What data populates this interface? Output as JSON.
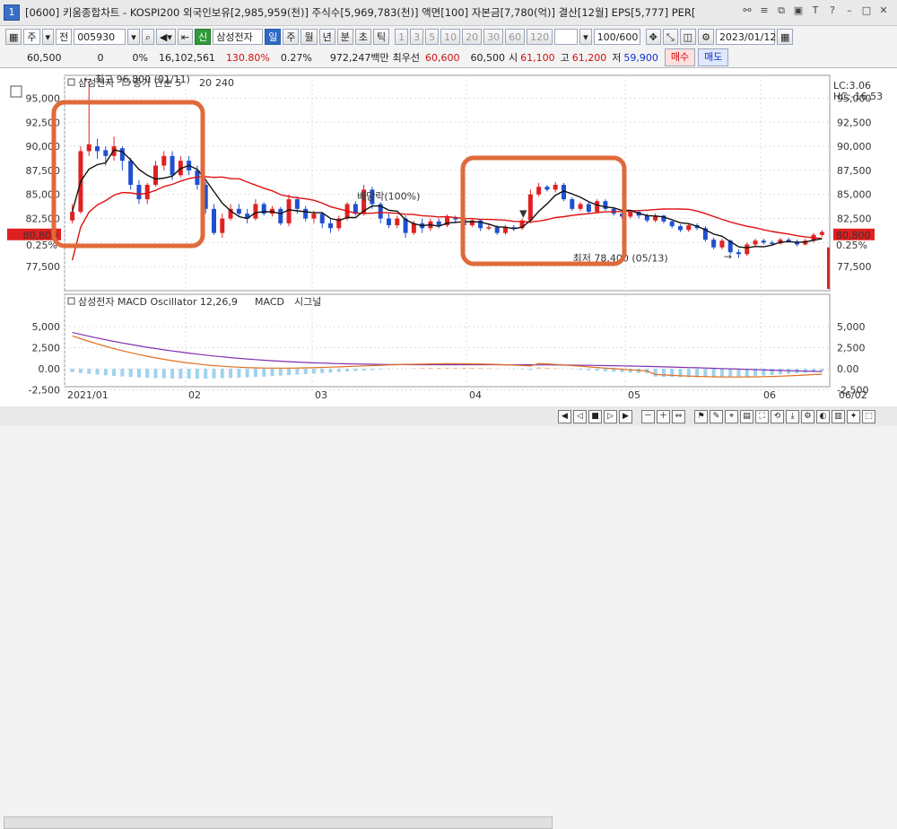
{
  "window": {
    "number": "1",
    "title": "[0600] 키움종합차트 - KOSPI200 외국인보유[2,985,959(천)] 주식수[5,969,783(천)] 액면[100] 자본금[7,780(억)] 결산[12월] EPS[5,777] PER["
  },
  "toolbar": {
    "type_label": "주",
    "market_label": "전",
    "code": "005930",
    "stock_name": "삼성전자",
    "periods": [
      "일",
      "주",
      "월",
      "년",
      "분",
      "초",
      "틱"
    ],
    "intervals": [
      "1",
      "3",
      "5",
      "10",
      "20",
      "30",
      "60",
      "120"
    ],
    "count": "100/600",
    "date": "2023/01/12"
  },
  "quote": {
    "price": "60,500",
    "change": "0",
    "rate": "0%",
    "volume": "16,102,561",
    "vol_ratio": "130.80%",
    "turnover": "0.27%",
    "amount": "972,247백만",
    "best_label": "최우선",
    "best_ask": "60,600",
    "best_bid": "60,500",
    "open_label": "시",
    "open": "61,100",
    "high_label": "고",
    "high": "61,200",
    "low_label": "저",
    "low": "59,900",
    "buy_label": "매수",
    "sell_label": "매도"
  },
  "chart": {
    "price_legend_name": "삼성전자",
    "ma_legend": "종가 단순 5",
    "ma20": "20",
    "ma240": "240",
    "max_label": "최고 96,800 (01/11)",
    "min_label": "최저 78,400 (05/13)",
    "dividend_label": "배당락(100%)",
    "current_price": "80,800",
    "current_rate": "0.25%",
    "lc_label": "LC:3.06",
    "hc_label": "HC:-16.53",
    "price_ticks": [
      "95,000",
      "92,500",
      "90,000",
      "87,500",
      "85,000",
      "82,500",
      "80,000",
      "77,500"
    ],
    "macd_legend": "삼성전자 MACD Oscillator 12,26,9",
    "macd_label": "MACD",
    "signal_label": "시그널",
    "macd_ticks": [
      "5,000",
      "2,500",
      "0.00",
      "-2,500"
    ],
    "date_ticks": [
      "2021/01",
      "02",
      "03",
      "04",
      "05",
      "06",
      "06/02"
    ]
  },
  "chart_data": {
    "type": "line",
    "title": "",
    "xlabel": "",
    "ylabel": "",
    "x": [
      "2021/01",
      "02",
      "03",
      "04",
      "05",
      "06"
    ],
    "series": [
      {
        "name": "종가 단순 5",
        "values": [
          88000,
          84500,
          82500,
          82000,
          81200,
          80800
        ]
      },
      {
        "name": "20",
        "values": [
          80000,
          84800,
          83000,
          81500,
          82200,
          80800
        ]
      }
    ],
    "ylim": [
      75000,
      97000
    ],
    "annotations": [
      "최고 96,800 (01/11)",
      "최저 78,400 (05/13)",
      "배당락(100%)"
    ],
    "grid": true
  },
  "colors": {
    "up": "#e02020",
    "down": "#2050d0",
    "ma5": "#111111",
    "ma20": "#e01010",
    "macd": "#e07020",
    "signal": "#8030b0",
    "highlight": "#e06a3a"
  }
}
